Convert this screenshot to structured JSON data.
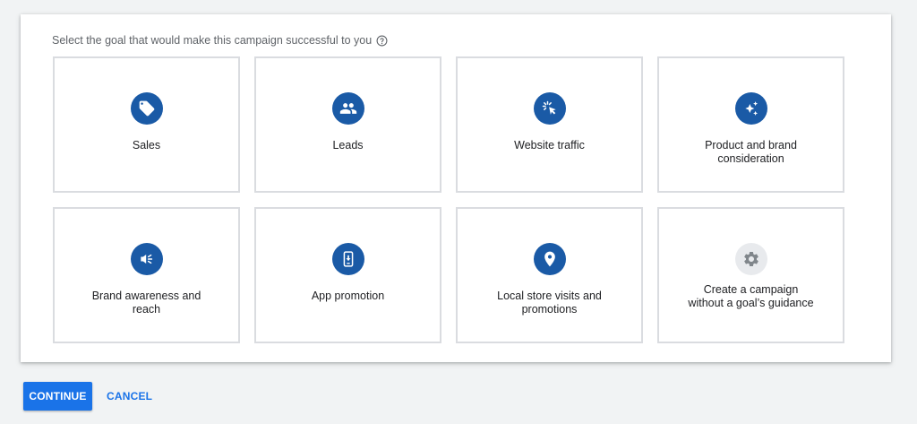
{
  "prompt": {
    "text": "Select the goal that would make this campaign successful to you",
    "help_icon": "help-circle-icon"
  },
  "goals": [
    {
      "label": "Sales",
      "icon": "tag-icon"
    },
    {
      "label": "Leads",
      "icon": "people-icon"
    },
    {
      "label": "Website traffic",
      "icon": "cursor-click-icon"
    },
    {
      "label": "Product and brand consideration",
      "icon": "sparkle-icon"
    },
    {
      "label": "Brand awareness and reach",
      "icon": "megaphone-icon"
    },
    {
      "label": "App promotion",
      "icon": "phone-download-icon"
    },
    {
      "label": "Local store visits and promotions",
      "icon": "location-pin-icon"
    },
    {
      "label": "Create a campaign without a goal’s guidance",
      "icon": "gear-icon"
    }
  ],
  "actions": {
    "continue_label": "CONTINUE",
    "cancel_label": "CANCEL"
  },
  "colors": {
    "icon_bg": "#1a5aa6",
    "icon_bg_muted": "#e8eaed",
    "primary": "#1a73e8",
    "card_border": "#dadce0",
    "page_bg": "#f1f3f4"
  }
}
